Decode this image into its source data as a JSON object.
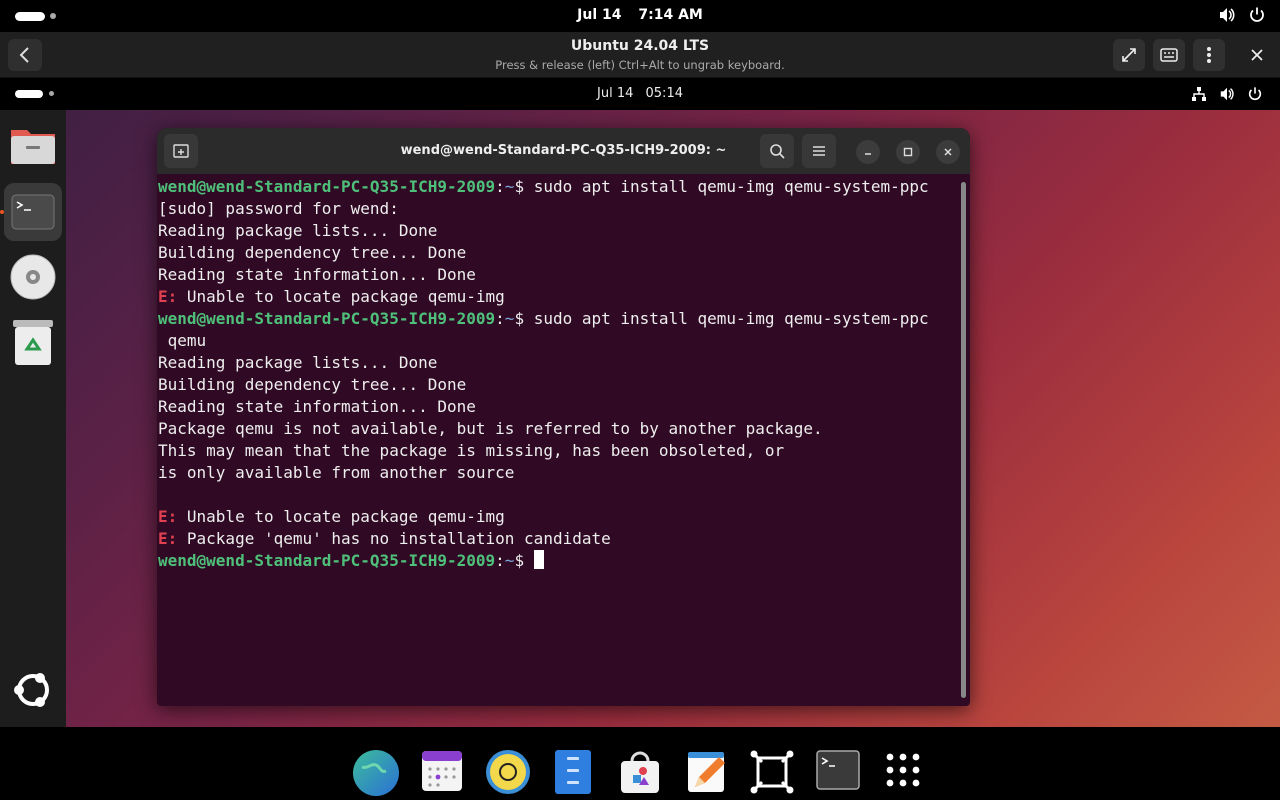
{
  "host_top": {
    "date": "Jul 14",
    "time": "7:14 AM"
  },
  "vm_window": {
    "title": "Ubuntu 24.04 LTS",
    "subtitle": "Press & release (left) Ctrl+Alt to ungrab keyboard."
  },
  "guest_top": {
    "date": "Jul 14",
    "time": "05:14"
  },
  "terminal": {
    "title": "wend@wend-Standard-PC-Q35-ICH9-2009: ~",
    "prompt": "wend@wend-Standard-PC-Q35-ICH9-2009",
    "path": "~",
    "lines": [
      {
        "cmd": "sudo apt install qemu-img qemu-system-ppc"
      },
      {
        "text": "[sudo] password for wend:"
      },
      {
        "text": "Reading package lists... Done"
      },
      {
        "text": "Building dependency tree... Done"
      },
      {
        "text": "Reading state information... Done"
      },
      {
        "err": "E:",
        "text": " Unable to locate package qemu-img"
      },
      {
        "cmd": "sudo apt install qemu-img qemu-system-ppc"
      },
      {
        "text": " qemu"
      },
      {
        "text": "Reading package lists... Done"
      },
      {
        "text": "Building dependency tree... Done"
      },
      {
        "text": "Reading state information... Done"
      },
      {
        "text": "Package qemu is not available, but is referred to by another package."
      },
      {
        "text": "This may mean that the package is missing, has been obsoleted, or"
      },
      {
        "text": "is only available from another source"
      },
      {
        "text": ""
      },
      {
        "err": "E:",
        "text": " Unable to locate package qemu-img"
      },
      {
        "err": "E:",
        "text": " Package 'qemu' has no installation candidate"
      },
      {
        "cmd": "",
        "cursor": true
      }
    ]
  },
  "guest_dock": [
    "files-icon",
    "terminal-icon",
    "disc-icon",
    "trash-icon",
    "ubuntu-logo-icon"
  ],
  "taskbar": [
    "browser-icon",
    "calendar-icon",
    "music-icon",
    "file-manager-icon",
    "software-store-icon",
    "text-editor-icon",
    "boxes-icon",
    "terminal-icon",
    "app-grid-icon"
  ]
}
